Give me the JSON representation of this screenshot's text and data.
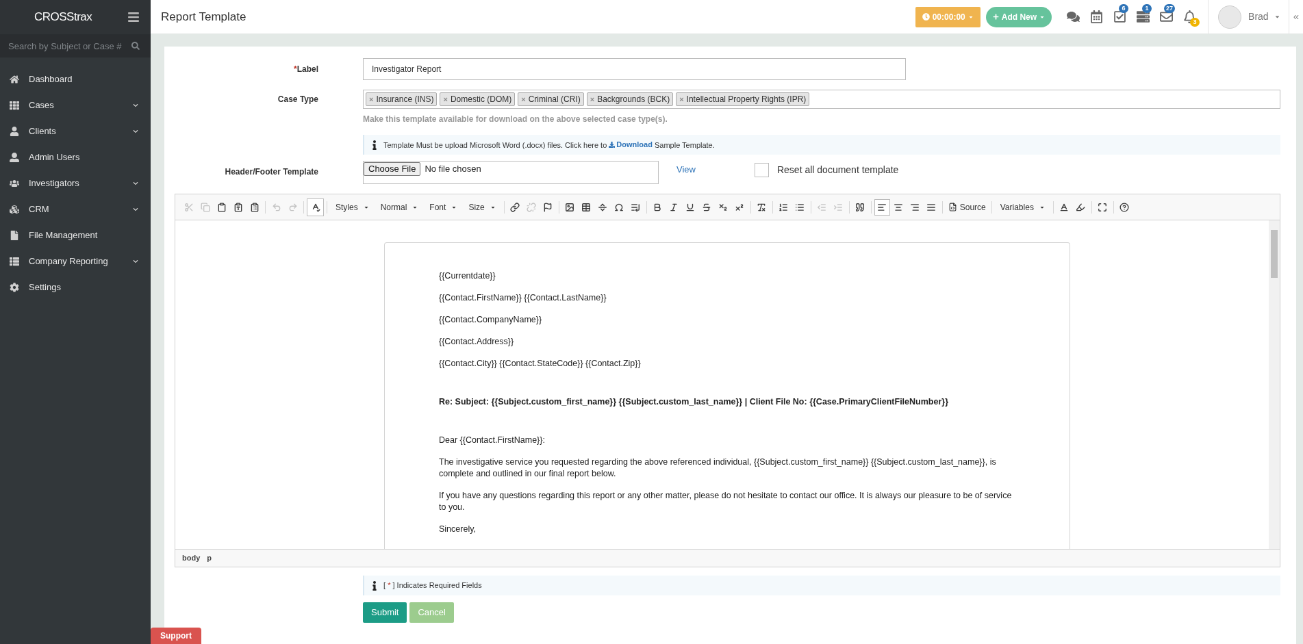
{
  "sidebar": {
    "logo": "CROSStrax",
    "search": {
      "placeholder": "Search by Subject or Case #"
    },
    "items": [
      {
        "label": "Dashboard",
        "expandable": false
      },
      {
        "label": "Cases",
        "expandable": true
      },
      {
        "label": "Clients",
        "expandable": true
      },
      {
        "label": "Admin Users",
        "expandable": false
      },
      {
        "label": "Investigators",
        "expandable": true
      },
      {
        "label": "CRM",
        "expandable": true
      },
      {
        "label": "File Management",
        "expandable": false
      },
      {
        "label": "Company Reporting",
        "expandable": true
      },
      {
        "label": "Settings",
        "expandable": false
      }
    ]
  },
  "header": {
    "title": "Report Template",
    "timer": "00:00:00",
    "add_new": "Add New",
    "notifications": [
      {
        "kind": "chat"
      },
      {
        "kind": "calendar"
      },
      {
        "kind": "tasks",
        "count": "6"
      },
      {
        "kind": "list",
        "count": "1"
      },
      {
        "kind": "mail",
        "count": "27"
      },
      {
        "kind": "bell",
        "count": "3"
      }
    ],
    "user": "Brad",
    "collapse": "«"
  },
  "form": {
    "label": {
      "caption": "Label",
      "required_mark": "*",
      "value": "Investigator Report"
    },
    "case_type": {
      "caption": "Case Type",
      "tags": [
        "Insurance (INS)",
        "Domestic (DOM)",
        "Criminal (CRI)",
        "Backgrounds (BCK)",
        "Intellectual Property Rights (IPR)"
      ],
      "remove_mark": "×",
      "hint": "Make this template available for download on the above selected case type(s)."
    },
    "info": {
      "text_before": "Template Must be upload Microsoft Word (.docx) files. Click here to",
      "link": "Download",
      "text_after": "Sample Template."
    },
    "header_footer": {
      "caption": "Header/Footer Template",
      "button": "Choose File",
      "file": "No file chosen",
      "view": "View",
      "reset": {
        "label": "Reset all document template",
        "checked": false
      }
    }
  },
  "editor": {
    "toolbar": [
      [
        {
          "kind": "cut",
          "disabled": true
        },
        {
          "kind": "copy",
          "disabled": true
        },
        {
          "kind": "paste",
          "disabled": false
        },
        {
          "kind": "paste-text",
          "disabled": false
        },
        {
          "kind": "paste-word",
          "disabled": false
        }
      ],
      [
        {
          "kind": "undo",
          "disabled": true
        },
        {
          "kind": "redo",
          "disabled": true
        }
      ],
      [
        {
          "kind": "spellcheck",
          "disabled": false
        }
      ],
      [
        {
          "kind": "dropdown",
          "label": "Styles"
        },
        {
          "kind": "dropdown",
          "label": "Normal"
        },
        {
          "kind": "dropdown",
          "label": "Font"
        },
        {
          "kind": "dropdown",
          "label": "Size"
        }
      ],
      [
        {
          "kind": "link",
          "disabled": false
        },
        {
          "kind": "unlink",
          "disabled": true
        },
        {
          "kind": "anchor",
          "disabled": false
        }
      ],
      [
        {
          "kind": "image",
          "disabled": false
        },
        {
          "kind": "table",
          "disabled": false
        },
        {
          "kind": "rule",
          "disabled": false
        },
        {
          "kind": "omega",
          "disabled": false
        },
        {
          "kind": "pagebreak",
          "disabled": false
        }
      ],
      [
        {
          "kind": "bold",
          "disabled": false
        },
        {
          "kind": "italic",
          "disabled": false
        },
        {
          "kind": "underline",
          "disabled": false
        },
        {
          "kind": "strike",
          "disabled": false
        },
        {
          "kind": "subscript",
          "disabled": false
        },
        {
          "kind": "superscript",
          "disabled": false
        }
      ],
      [
        {
          "kind": "clear-format",
          "disabled": false
        }
      ],
      [
        {
          "kind": "ordered-list",
          "disabled": false
        },
        {
          "kind": "bullet-list",
          "disabled": false
        }
      ],
      [
        {
          "kind": "outdent",
          "disabled": true
        },
        {
          "kind": "indent",
          "disabled": true
        }
      ],
      [
        {
          "kind": "quote",
          "disabled": false
        }
      ],
      [
        {
          "kind": "align-left",
          "selected": true
        },
        {
          "kind": "align-center",
          "selected": false
        },
        {
          "kind": "align-right",
          "selected": false
        },
        {
          "kind": "align-justify",
          "selected": false
        }
      ],
      [
        {
          "kind": "source",
          "label": "Source"
        }
      ],
      [
        {
          "kind": "dropdown",
          "label": "Variables"
        }
      ],
      [
        {
          "kind": "text-color",
          "disabled": false
        },
        {
          "kind": "bg-color",
          "disabled": false
        }
      ],
      [
        {
          "kind": "maximize",
          "disabled": false
        }
      ],
      [
        {
          "kind": "help",
          "disabled": false
        }
      ]
    ],
    "paragraphs": [
      {
        "text": "{{Currentdate}}",
        "bold": false,
        "space_before": false
      },
      {
        "text": "{{Contact.FirstName}} {{Contact.LastName}}",
        "bold": false,
        "space_before": false
      },
      {
        "text": "{{Contact.CompanyName}}",
        "bold": false,
        "space_before": false
      },
      {
        "text": "{{Contact.Address}}",
        "bold": false,
        "space_before": false
      },
      {
        "text": "{{Contact.City}} {{Contact.StateCode}} {{Contact.Zip}}",
        "bold": false,
        "space_before": false
      },
      {
        "text": "Re: Subject: {{Subject.custom_first_name}} {{Subject.custom_last_name}} | Client File No: {{Case.PrimaryClientFileNumber}}",
        "bold": true,
        "space_before": true
      },
      {
        "text": "Dear {{Contact.FirstName}}:",
        "bold": false,
        "space_before": true
      },
      {
        "text": "The investigative service you requested regarding the above referenced individual, {{Subject.custom_first_name}} {{Subject.custom_last_name}}, is complete and outlined in our final report below.",
        "bold": false,
        "space_before": false
      },
      {
        "text": "If you have any questions regarding this report or any other matter, please do not hesitate to contact our office. It is always our pleasure to be of service to you.",
        "bold": false,
        "space_before": false
      },
      {
        "text": "Sincerely,",
        "bold": false,
        "space_before": false
      }
    ],
    "path": [
      "body",
      "p"
    ]
  },
  "required_note": {
    "open": "[",
    "mark": "*",
    "close": "] Indicates Required Fields"
  },
  "buttons": [
    "Submit",
    "Cancel"
  ],
  "support": "Support"
}
